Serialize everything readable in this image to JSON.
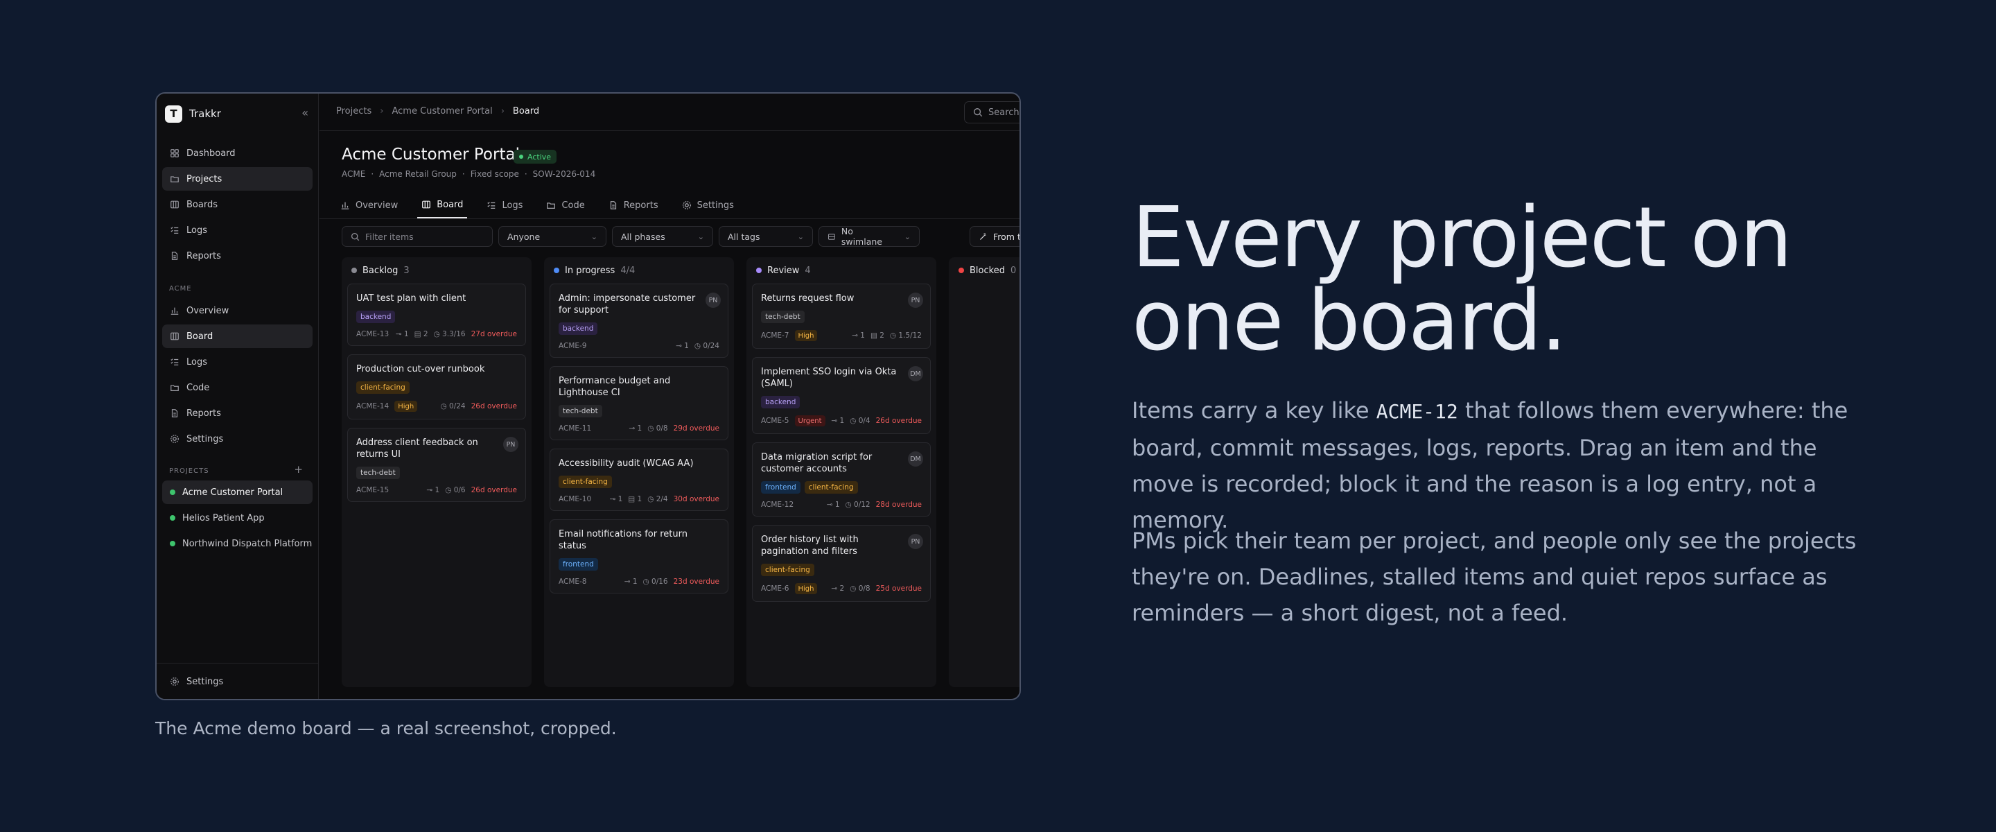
{
  "sidebar": {
    "brand": {
      "logo": "T",
      "name": "Trakkr"
    },
    "collapse_icon": "chevrons-left-icon",
    "nav": [
      {
        "label": "Dashboard",
        "icon": "dashboard-icon"
      },
      {
        "label": "Projects",
        "icon": "folder-icon",
        "active": true
      },
      {
        "label": "Boards",
        "icon": "board-icon"
      },
      {
        "label": "Logs",
        "icon": "list-icon"
      },
      {
        "label": "Reports",
        "icon": "file-icon"
      }
    ],
    "section_label": "ACME",
    "section_nav": [
      {
        "label": "Overview",
        "icon": "chart-icon"
      },
      {
        "label": "Board",
        "icon": "board-icon",
        "active": true
      },
      {
        "label": "Logs",
        "icon": "list-icon"
      },
      {
        "label": "Code",
        "icon": "folder-icon"
      },
      {
        "label": "Reports",
        "icon": "file-icon"
      },
      {
        "label": "Settings",
        "icon": "gear-icon"
      }
    ],
    "projects_label": "PROJECTS",
    "projects": [
      {
        "label": "Acme Customer Portal",
        "active": true
      },
      {
        "label": "Helios Patient App"
      },
      {
        "label": "Northwind Dispatch Platform"
      }
    ],
    "bottom": {
      "label": "Settings"
    }
  },
  "topbar": {
    "breadcrumbs": [
      "Projects",
      "Acme Customer Portal",
      "Board"
    ],
    "search_placeholder": "Search"
  },
  "project": {
    "title": "Acme Customer Portal",
    "status": "Active",
    "meta": [
      "ACME",
      "·",
      "Acme Retail Group",
      "·",
      "Fixed scope",
      "·",
      "SOW-2026-014"
    ]
  },
  "tabs": [
    {
      "label": "Overview",
      "icon": "chart-icon"
    },
    {
      "label": "Board",
      "icon": "board-icon",
      "active": true
    },
    {
      "label": "Logs",
      "icon": "list-icon"
    },
    {
      "label": "Code",
      "icon": "folder-icon"
    },
    {
      "label": "Reports",
      "icon": "file-icon"
    },
    {
      "label": "Settings",
      "icon": "gear-icon"
    }
  ],
  "filters": {
    "search_placeholder": "Filter items",
    "assignee": "Anyone",
    "phases": "All phases",
    "tags": "All tags",
    "swimlane": "No swimlane",
    "template": "From te"
  },
  "colors": {
    "backlog": "#8a8a92",
    "in_progress": "#4f8cf7",
    "review": "#a78bfa",
    "blocked": "#ef4444",
    "backend": "#a78bfa",
    "tech_debt": "#c4c4ca",
    "client_facing": "#f5b544",
    "frontend": "#60a5fa",
    "high": "#f5b544",
    "urgent": "#ef5b5b",
    "overdue": "#ef5b5b"
  },
  "columns": [
    {
      "name": "Backlog",
      "count": "3",
      "dot": "#8a8a92",
      "cards": [
        {
          "title": "UAT test plan with client",
          "tags": [
            "backend"
          ],
          "key": "ACME-13",
          "links": "1",
          "comments": "2",
          "time": "3.3/16",
          "overdue": "27d overdue"
        },
        {
          "title": "Production cut-over runbook",
          "tags": [
            "client-facing"
          ],
          "key": "ACME-14",
          "priority": "High",
          "time": "0/24",
          "overdue": "26d overdue"
        },
        {
          "title": "Address client feedback on returns UI",
          "assignee": "PN",
          "tags": [
            "tech-debt"
          ],
          "key": "ACME-15",
          "links": "1",
          "time": "0/6",
          "overdue": "26d overdue"
        }
      ]
    },
    {
      "name": "In progress",
      "count": "4/4",
      "dot": "#4f8cf7",
      "cards": [
        {
          "title": "Admin: impersonate customer for support",
          "assignee": "PN",
          "tags": [
            "backend"
          ],
          "key": "ACME-9",
          "links": "1",
          "time": "0/24"
        },
        {
          "title": "Performance budget and Lighthouse CI",
          "tags": [
            "tech-debt"
          ],
          "key": "ACME-11",
          "links": "1",
          "time": "0/8",
          "overdue": "29d overdue"
        },
        {
          "title": "Accessibility audit (WCAG AA)",
          "tags": [
            "client-facing"
          ],
          "key": "ACME-10",
          "links": "1",
          "comments": "1",
          "time": "2/4",
          "overdue": "30d overdue"
        },
        {
          "title": "Email notifications for return status",
          "tags": [
            "frontend"
          ],
          "key": "ACME-8",
          "links": "1",
          "time": "0/16",
          "overdue": "23d overdue"
        }
      ]
    },
    {
      "name": "Review",
      "count": "4",
      "dot": "#a78bfa",
      "cards": [
        {
          "title": "Returns request flow",
          "assignee": "PN",
          "tags": [
            "tech-debt"
          ],
          "key": "ACME-7",
          "priority": "High",
          "links": "1",
          "comments": "2",
          "time": "1.5/12"
        },
        {
          "title": "Implement SSO login via Okta (SAML)",
          "assignee": "DM",
          "tags": [
            "backend"
          ],
          "key": "ACME-5",
          "priority": "Urgent",
          "links": "1",
          "time": "0/4",
          "overdue": "26d overdue"
        },
        {
          "title": "Data migration script for customer accounts",
          "assignee": "DM",
          "tags": [
            "frontend",
            "client-facing"
          ],
          "key": "ACME-12",
          "links": "1",
          "time": "0/12",
          "overdue": "28d overdue"
        },
        {
          "title": "Order history list with pagination and filters",
          "assignee": "PN",
          "tags": [
            "client-facing"
          ],
          "key": "ACME-6",
          "priority": "High",
          "links": "2",
          "time": "0/8",
          "overdue": "25d overdue"
        }
      ]
    },
    {
      "name": "Blocked",
      "count": "0",
      "dot": "#ef4444",
      "cards": []
    }
  ],
  "caption": "The Acme demo board — a real screenshot, cropped.",
  "copy": {
    "headline_1": "Every project on",
    "headline_2": "one board.",
    "para1_a": "Items carry a key like ",
    "para1_code": "ACME-12",
    "para1_b": " that follows them everywhere: the board, commit messages, logs, reports. Drag an item and the move is recorded; block it and the reason is a log entry, not a memory.",
    "para2": "PMs pick their team per project, and people only see the projects they're on. Deadlines, stalled items and quiet repos surface as reminders — a short digest, not a feed."
  }
}
